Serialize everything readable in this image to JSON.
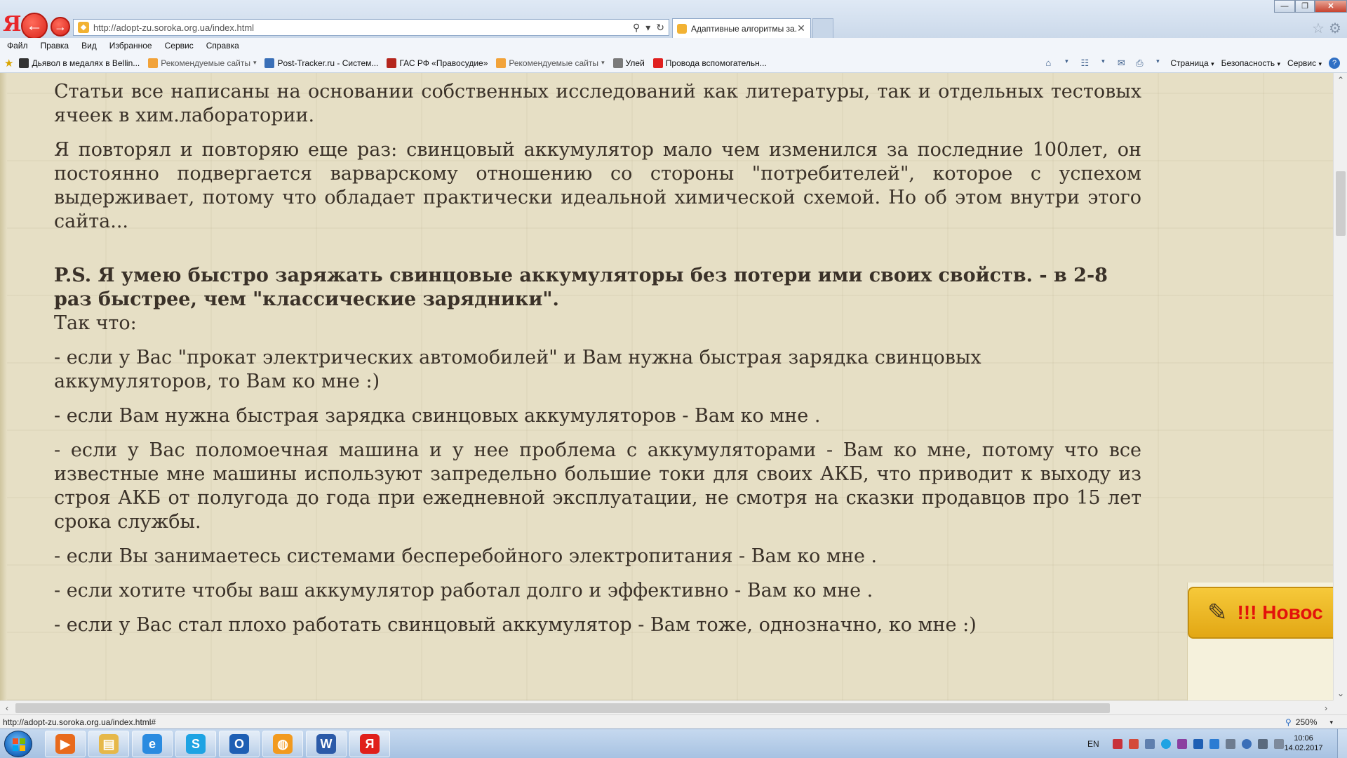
{
  "browser": {
    "address_url": "http://adopt-zu.soroka.org.ua/index.html",
    "tab_title": "Адаптивные алгоритмы за...",
    "menu": [
      "Файл",
      "Правка",
      "Вид",
      "Избранное",
      "Сервис",
      "Справка"
    ],
    "favorites": [
      {
        "label": "Дьявол в медалях в Bellin...",
        "icon_color": "#333333",
        "muted": false,
        "dropdown": false
      },
      {
        "label": "Рекомендуемые сайты",
        "icon_color": "#f2a33a",
        "muted": true,
        "dropdown": true
      },
      {
        "label": "Post-Tracker.ru - Систем...",
        "icon_color": "#3a6fb7",
        "muted": false,
        "dropdown": false
      },
      {
        "label": "ГАС РФ «Правосудие»",
        "icon_color": "#b5261e",
        "muted": false,
        "dropdown": false
      },
      {
        "label": "Рекомендуемые сайты",
        "icon_color": "#f2a33a",
        "muted": true,
        "dropdown": true
      },
      {
        "label": "Улей",
        "icon_color": "#7a7a7a",
        "muted": false,
        "dropdown": false
      },
      {
        "label": "Провода вспомогательн...",
        "icon_color": "#e02020",
        "muted": false,
        "dropdown": false
      }
    ],
    "commands": {
      "page": "Страница",
      "safety": "Безопасность",
      "service": "Сервис"
    },
    "status_url": "http://adopt-zu.soroka.org.ua/index.html#",
    "zoom": "250%"
  },
  "article": {
    "p1": "Статьи все написаны на основании собственных исследований как литературы, так и отдельных тестовых ячеек в хим.лаборатории.",
    "p2": "Я повторял и повторяю еще раз: свинцовый аккумулятор мало чем изменился за последние 100лет, он постоянно подвергается варварскому отношению со стороны \"потребителей\", которое с успехом выдерживает, потому что обладает практически идеальной химической схемой. Но об этом внутри этого сайта...",
    "ps": "P.S. Я умею быстро заряжать свинцовые аккумуляторы без потери ими своих свойств. - в 2-8 раз быстрее, чем \"классические зарядники\".",
    "so": "Так что:",
    "items": [
      "- если у Вас \"прокат электрических автомобилей\" и Вам нужна быстрая зарядка свинцовых аккумуляторов, то Вам ко мне :)",
      "- если Вам нужна быстрая зарядка свинцовых аккумуляторов - Вам ко мне .",
      "- если у Вас поломоечная машина и у нее проблема с аккумуляторами - Вам ко мне, потому что все известные мне машины используют запредельно большие токи для своих АКБ, что приводит к выходу из строя АКБ от полугода до года при ежедневной эксплуатации, не смотря на сказки продавцов про 15 лет срока службы.",
      "- если Вы занимаетесь системами бесперебойного электропитания - Вам ко мне .",
      "- если хотите чтобы ваш аккумулятор работал долго и эффективно - Вам ко мне .",
      "- если у Вас стал плохо работать свинцовый аккумулятор - Вам тоже, однозначно, ко мне :)"
    ]
  },
  "widget": {
    "label": "!!! Новос"
  },
  "taskbar": {
    "apps": [
      {
        "name": "media-player",
        "color": "#e86a1c",
        "glyph": "▶"
      },
      {
        "name": "file-explorer",
        "color": "#e6b84a",
        "glyph": "▤"
      },
      {
        "name": "internet-explorer",
        "color": "#2a8be0",
        "glyph": "e"
      },
      {
        "name": "skype",
        "color": "#1ea3e3",
        "glyph": "S"
      },
      {
        "name": "outlook",
        "color": "#1e5fb4",
        "glyph": "O"
      },
      {
        "name": "chat-app",
        "color": "#f29a1f",
        "glyph": "◍"
      },
      {
        "name": "word",
        "color": "#2b5aa8",
        "glyph": "W"
      },
      {
        "name": "yandex-browser",
        "color": "#e0201b",
        "glyph": "Я"
      }
    ],
    "lang": "EN",
    "time": "10:06",
    "date": "14.02.2017"
  },
  "colors": {
    "page_bg": "#e6dfc5",
    "text": "#3a3128",
    "news_text": "#e3120b",
    "news_button": "#f2bf2e"
  }
}
